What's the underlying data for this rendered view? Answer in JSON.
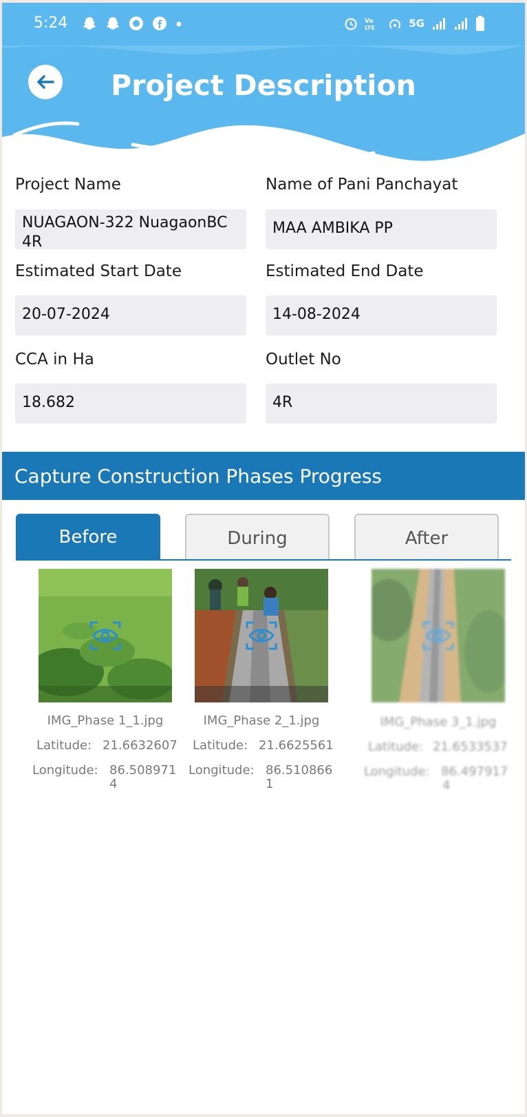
{
  "status_bar": {
    "time": "5:24",
    "left_icons": [
      "snapchat-icon",
      "snapchat-icon",
      "app-icon",
      "facebook-icon",
      "dot-icon"
    ],
    "right_icons": [
      "alarm-icon",
      "volte-icon",
      "hotspot-icon",
      "5g-icon",
      "signal-icon",
      "signal-icon",
      "battery-icon"
    ],
    "network": "5G"
  },
  "header": {
    "title": "Project Description",
    "back_icon": "arrow-left-icon"
  },
  "details": {
    "project_name_label": "Project Name",
    "project_name_value": "NUAGAON-322 NuagaonBC 4R",
    "pani_panchayat_label": "Name of Pani Panchayat",
    "pani_panchayat_value": "MAA AMBIKA PP",
    "start_date_label": "Estimated Start Date",
    "start_date_value": "20-07-2024",
    "end_date_label": "Estimated End Date",
    "end_date_value": "14-08-2024",
    "cca_label": "CCA in Ha",
    "cca_value": "18.682",
    "outlet_label": "Outlet No",
    "outlet_value": "4R"
  },
  "progress": {
    "section_title": "Capture Construction Phases Progress",
    "tabs": [
      {
        "label": "Before",
        "active": true
      },
      {
        "label": "During",
        "active": false
      },
      {
        "label": "After",
        "active": false
      }
    ],
    "images": [
      {
        "filename": "IMG_Phase 1_1.jpg",
        "lat_label": "Latitude:",
        "latitude": "21.6632607",
        "lon_label": "Longitude:",
        "longitude_line1": "86.508971",
        "longitude_line2": "4"
      },
      {
        "filename": "IMG_Phase 2_1.jpg",
        "lat_label": "Latitude:",
        "latitude": "21.6625561",
        "lon_label": "Longitude:",
        "longitude_line1": "86.510866",
        "longitude_line2": "1"
      },
      {
        "filename": "IMG_Phase 3_1.jpg",
        "lat_label": "Latitude:",
        "latitude": "21.6533537",
        "lon_label": "Longitude:",
        "longitude_line1": "86.497917",
        "longitude_line2": "4"
      }
    ]
  },
  "colors": {
    "header_blue": "#5ab8ef",
    "section_blue": "#1b78b7",
    "field_bg": "#eeeef0"
  }
}
